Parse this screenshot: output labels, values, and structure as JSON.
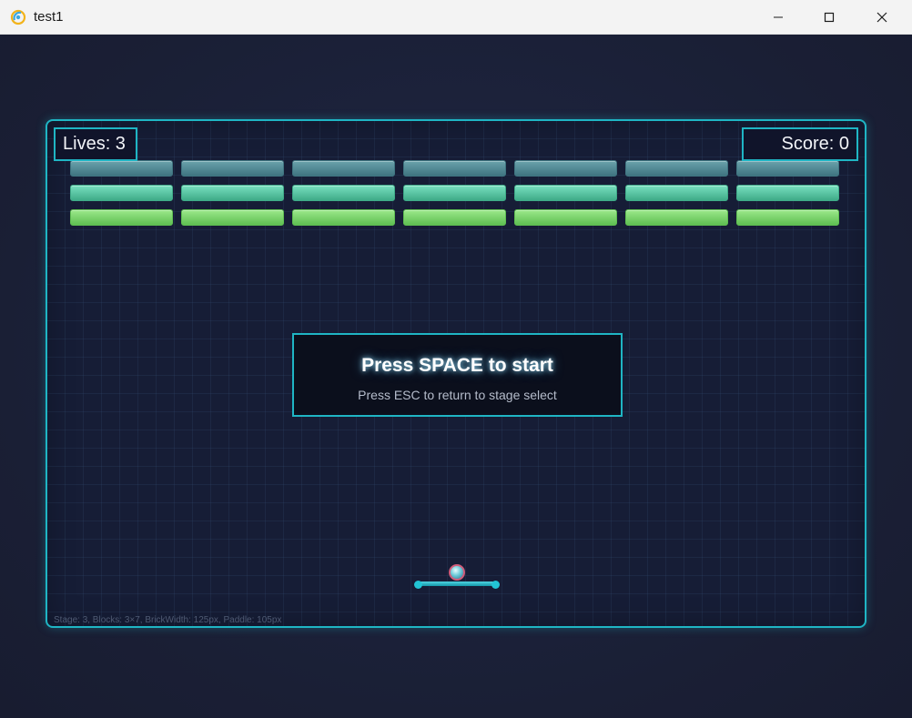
{
  "window": {
    "title": "test1",
    "controls": {
      "minimize_icon": "minimize-icon",
      "maximize_icon": "maximize-icon",
      "close_icon": "close-icon"
    }
  },
  "hud": {
    "lives": "Lives: 3",
    "score": "Score: 0"
  },
  "bricks": {
    "rows": 3,
    "cols": 7,
    "row_colors": [
      [
        "#6aa2ac",
        "#3f7480"
      ],
      [
        "#78e0c0",
        "#3fab88"
      ],
      [
        "#9be88a",
        "#5fbf52"
      ]
    ]
  },
  "overlay": {
    "title": "Press SPACE to start",
    "subtitle": "Press ESC to return to stage select"
  },
  "debug": "Stage: 3, Blocks: 3×7, BrickWidth: 125px, Paddle: 105px",
  "colors": {
    "accent": "#1fb5c4",
    "background": "#1a1f35"
  }
}
